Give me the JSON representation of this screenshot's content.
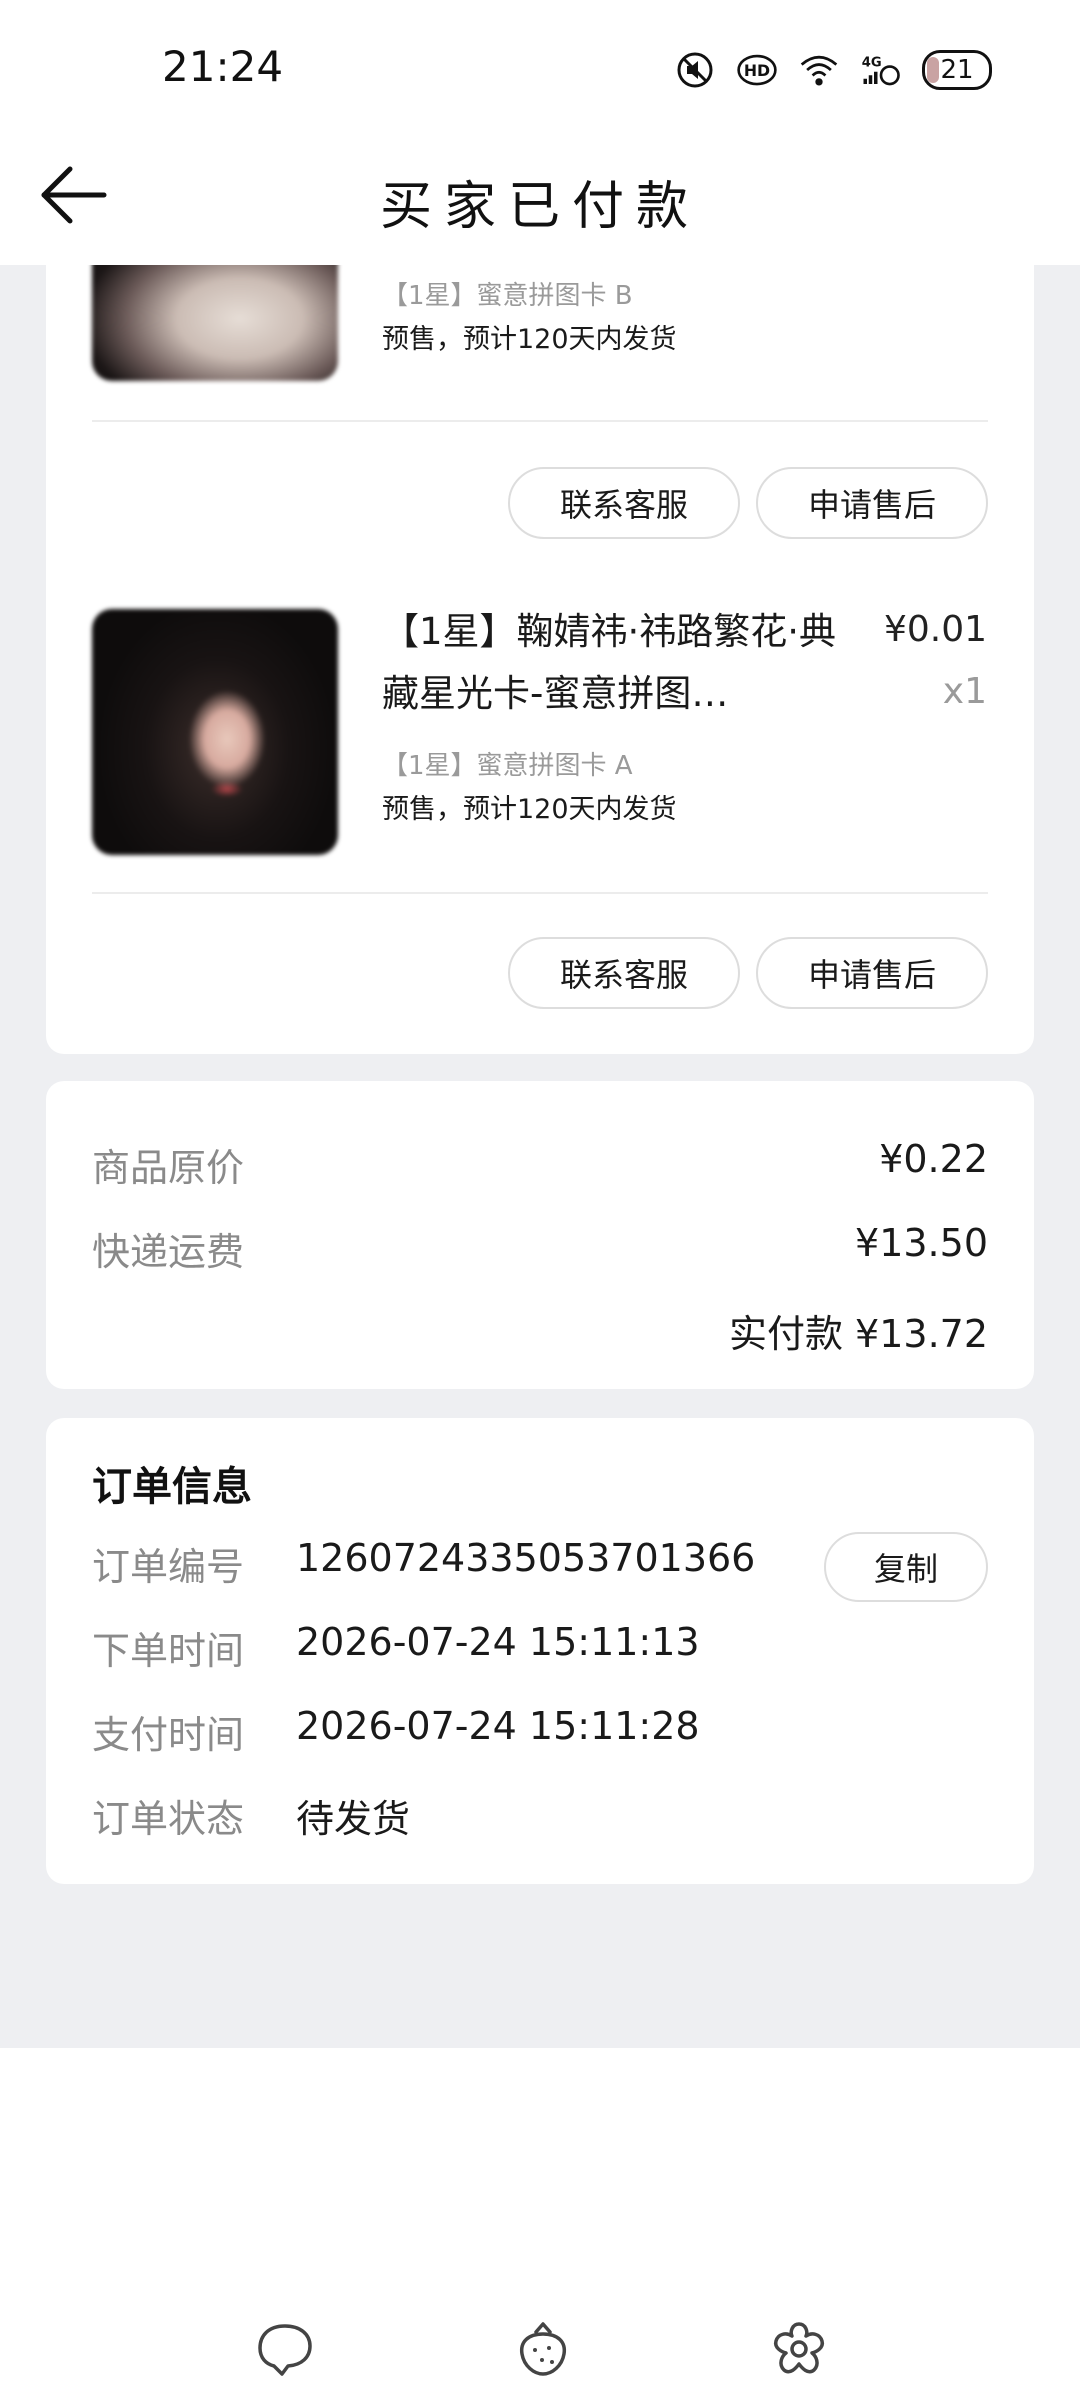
{
  "status_bar": {
    "time": "21:24",
    "battery": "21",
    "icons": [
      "mute-icon",
      "hd-icon",
      "wifi-icon",
      "4g-signal-icon"
    ]
  },
  "navbar": {
    "title": "买家已付款"
  },
  "items": [
    {
      "sku": "【1星】蜜意拼图卡 B",
      "note": "预售，预计120天内发货",
      "buttons": [
        "联系客服",
        "申请售后"
      ]
    },
    {
      "title": "【1星】鞠婧祎·祎路繁花·典藏星光卡-蜜意拼图…",
      "price": "¥0.01",
      "qty": "x1",
      "sku": "【1星】蜜意拼图卡 A",
      "note": "预售，预计120天内发货",
      "buttons": [
        "联系客服",
        "申请售后"
      ]
    }
  ],
  "price_summary": {
    "original_label": "商品原价",
    "original_value": "¥0.22",
    "shipping_label": "快递运费",
    "shipping_value": "¥13.50",
    "paid": "实付款 ¥13.72"
  },
  "order_info": {
    "title": "订单信息",
    "rows": [
      {
        "label": "订单编号",
        "value": "1260724335053701366"
      },
      {
        "label": "下单时间",
        "value": "2026-07-24 15:11:13"
      },
      {
        "label": "支付时间",
        "value": "2026-07-24 15:11:28"
      },
      {
        "label": "订单状态",
        "value": "待发货"
      }
    ],
    "copy_label": "复制"
  },
  "bottom_nav": {
    "icons": [
      "chat-bubble-icon",
      "strawberry-icon",
      "flower-icon"
    ]
  }
}
